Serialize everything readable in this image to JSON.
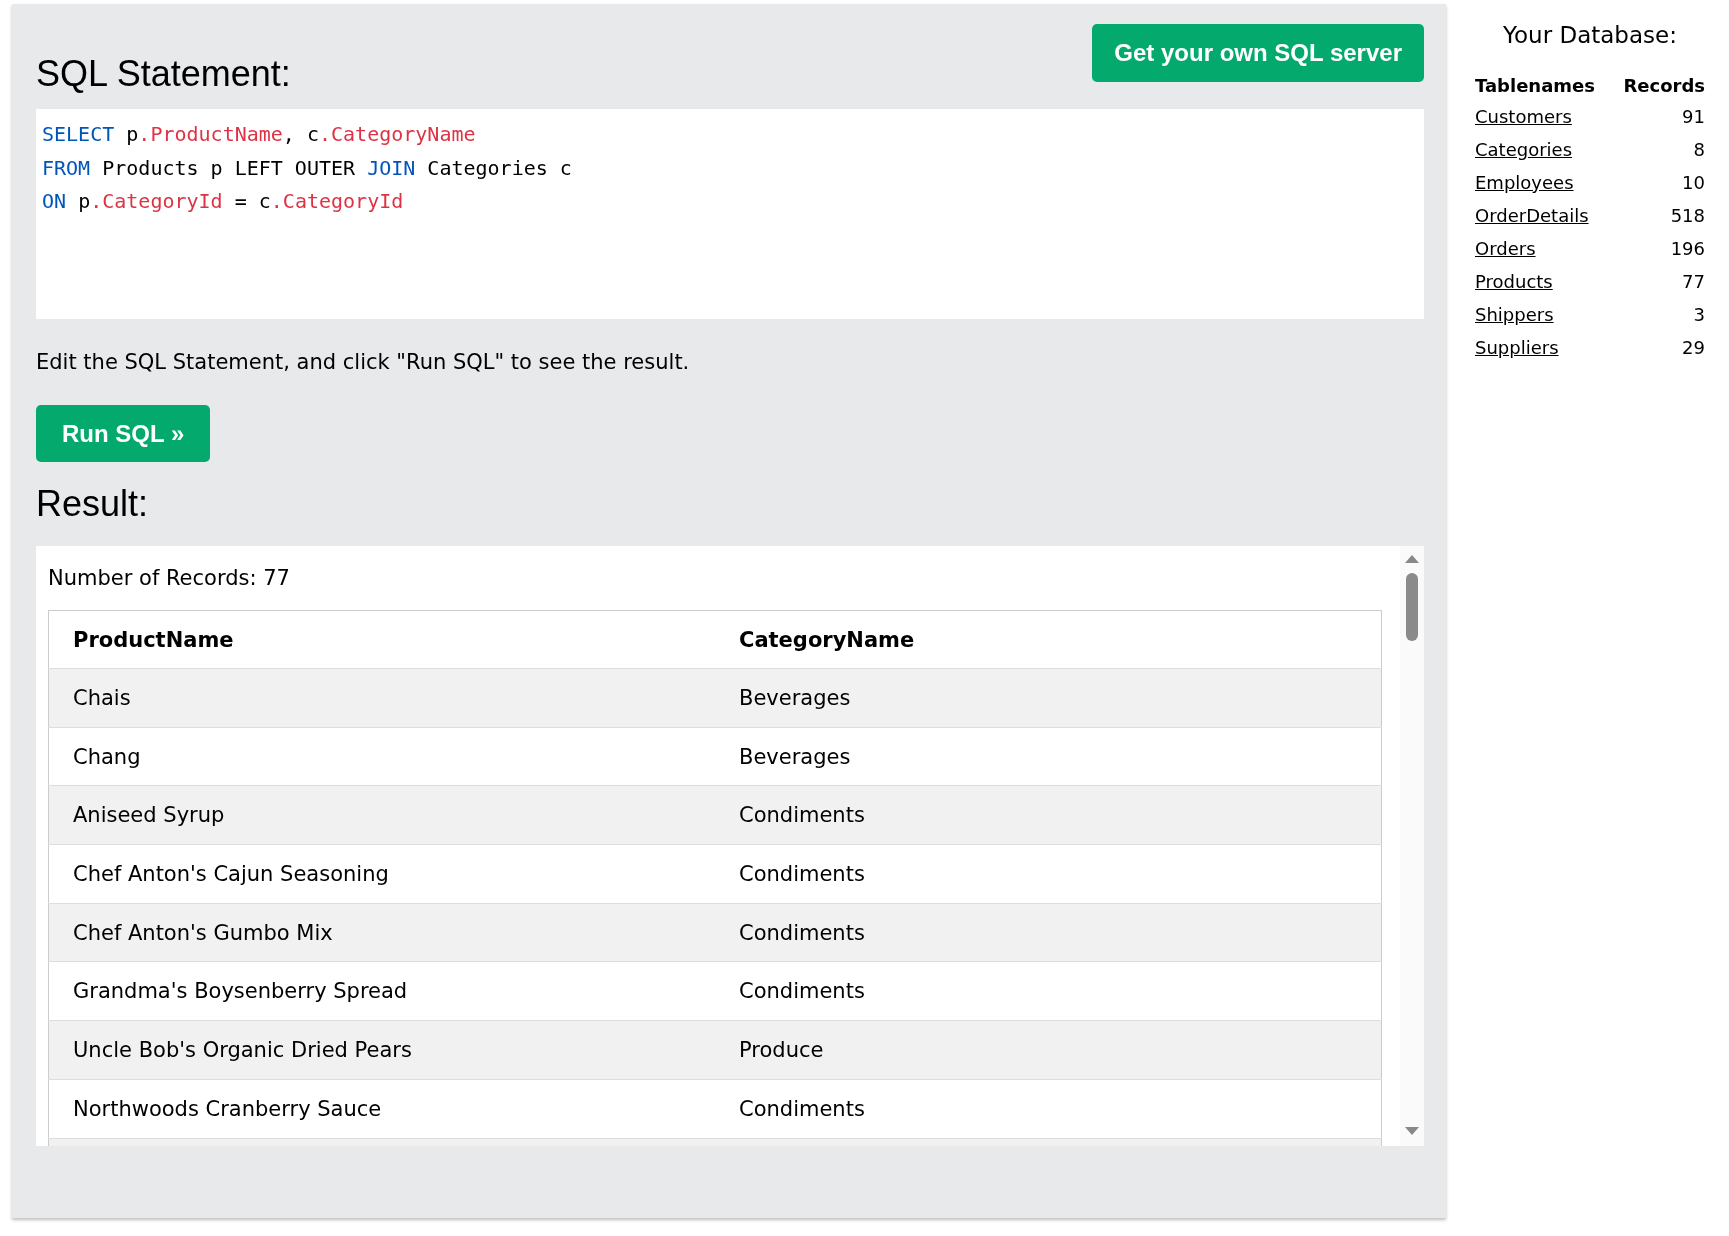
{
  "editor": {
    "title": "SQL Statement:",
    "server_button": "Get your own SQL server",
    "code_lines": [
      [
        {
          "kind": "keyword",
          "text": "SELECT"
        },
        {
          "kind": "plain",
          "text": " p"
        },
        {
          "kind": "column",
          "text": ".ProductName"
        },
        {
          "kind": "plain",
          "text": ", c"
        },
        {
          "kind": "column",
          "text": ".CategoryName"
        }
      ],
      [
        {
          "kind": "keyword",
          "text": "FROM"
        },
        {
          "kind": "plain",
          "text": " Products p LEFT OUTER "
        },
        {
          "kind": "keyword",
          "text": "JOIN"
        },
        {
          "kind": "plain",
          "text": " Categories c"
        }
      ],
      [
        {
          "kind": "keyword",
          "text": "ON"
        },
        {
          "kind": "plain",
          "text": " p"
        },
        {
          "kind": "column",
          "text": ".CategoryId"
        },
        {
          "kind": "plain",
          "text": " = c"
        },
        {
          "kind": "column",
          "text": ".CategoryId"
        }
      ]
    ],
    "instruction": "Edit the SQL Statement, and click \"Run SQL\" to see the result.",
    "run_button": "Run SQL »"
  },
  "result": {
    "title": "Result:",
    "record_count": "Number of Records: 77",
    "columns": [
      "ProductName",
      "CategoryName"
    ],
    "rows": [
      [
        "Chais",
        "Beverages"
      ],
      [
        "Chang",
        "Beverages"
      ],
      [
        "Aniseed Syrup",
        "Condiments"
      ],
      [
        "Chef Anton's Cajun Seasoning",
        "Condiments"
      ],
      [
        "Chef Anton's Gumbo Mix",
        "Condiments"
      ],
      [
        "Grandma's Boysenberry Spread",
        "Condiments"
      ],
      [
        "Uncle Bob's Organic Dried Pears",
        "Produce"
      ],
      [
        "Northwoods Cranberry Sauce",
        "Condiments"
      ]
    ]
  },
  "database": {
    "title": "Your Database:",
    "columns": [
      "Tablenames",
      "Records"
    ],
    "tables": [
      {
        "name": "Customers",
        "records": "91"
      },
      {
        "name": "Categories",
        "records": "8"
      },
      {
        "name": "Employees",
        "records": "10"
      },
      {
        "name": "OrderDetails",
        "records": "518"
      },
      {
        "name": "Orders",
        "records": "196"
      },
      {
        "name": "Products",
        "records": "77"
      },
      {
        "name": "Shippers",
        "records": "3"
      },
      {
        "name": "Suppliers",
        "records": "29"
      }
    ]
  }
}
